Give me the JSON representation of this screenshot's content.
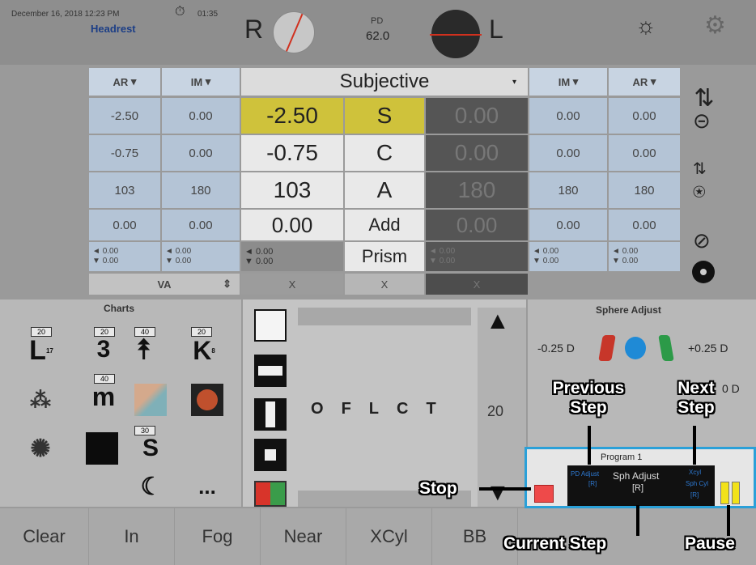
{
  "header": {
    "datetime": "December 16, 2018 12:23 PM",
    "timer": "01:35",
    "mode": "Headrest",
    "right_eye": "R",
    "left_eye": "L",
    "pd_label": "PD",
    "pd_value": "62.0"
  },
  "table": {
    "left_cols": [
      "AR",
      "IM"
    ],
    "right_cols": [
      "IM",
      "AR"
    ],
    "title": "Subjective",
    "rows": [
      {
        "label": "S",
        "ar_r": "-2.50",
        "im_r": "0.00",
        "r": "-2.50",
        "l": "0.00",
        "im_l": "0.00",
        "ar_l": "0.00"
      },
      {
        "label": "C",
        "ar_r": "-0.75",
        "im_r": "0.00",
        "r": "-0.75",
        "l": "0.00",
        "im_l": "0.00",
        "ar_l": "0.00"
      },
      {
        "label": "A",
        "ar_r": "103",
        "im_r": "180",
        "r": "103",
        "l": "180",
        "im_l": "180",
        "ar_l": "180"
      },
      {
        "label": "Add",
        "ar_r": "0.00",
        "im_r": "0.00",
        "r": "0.00",
        "l": "0.00",
        "im_l": "0.00",
        "ar_l": "0.00"
      }
    ],
    "prism_label": "Prism",
    "prism_value": "0.00",
    "va_label": "VA",
    "x_mark": "X"
  },
  "charts": {
    "title": "Charts",
    "tags": [
      "20",
      "20",
      "40",
      "20",
      "40",
      "30"
    ],
    "glyph_l": "L",
    "glyph_l_sub": "17",
    "glyph_3": "3",
    "glyph_k": "K",
    "glyph_k_sub": "8",
    "glyph_m": "m",
    "glyph_s": "S",
    "more": "..."
  },
  "optotype": {
    "letters": [
      "O",
      "F",
      "L",
      "C",
      "T"
    ],
    "size": "20"
  },
  "sphere_adjust": {
    "title": "Sphere Adjust",
    "minus": "-0.25 D",
    "plus": "+0.25 D",
    "partial_right": "0 D"
  },
  "program": {
    "title": "Program 1",
    "prev_step": "PD Adjust",
    "prev_eye": "[R]",
    "current_step": "Sph Adjust",
    "current_eye": "[R]",
    "next_step": "Xcyl",
    "next_step_2": "Sph Cyl",
    "next_eye": "[R]"
  },
  "bottom": [
    "Clear",
    "In",
    "Fog",
    "Near",
    "XCyl",
    "BB"
  ],
  "callouts": {
    "previous": "Previous Step",
    "next": "Next Step",
    "stop": "Stop",
    "current": "Current Step",
    "pause": "Pause"
  }
}
